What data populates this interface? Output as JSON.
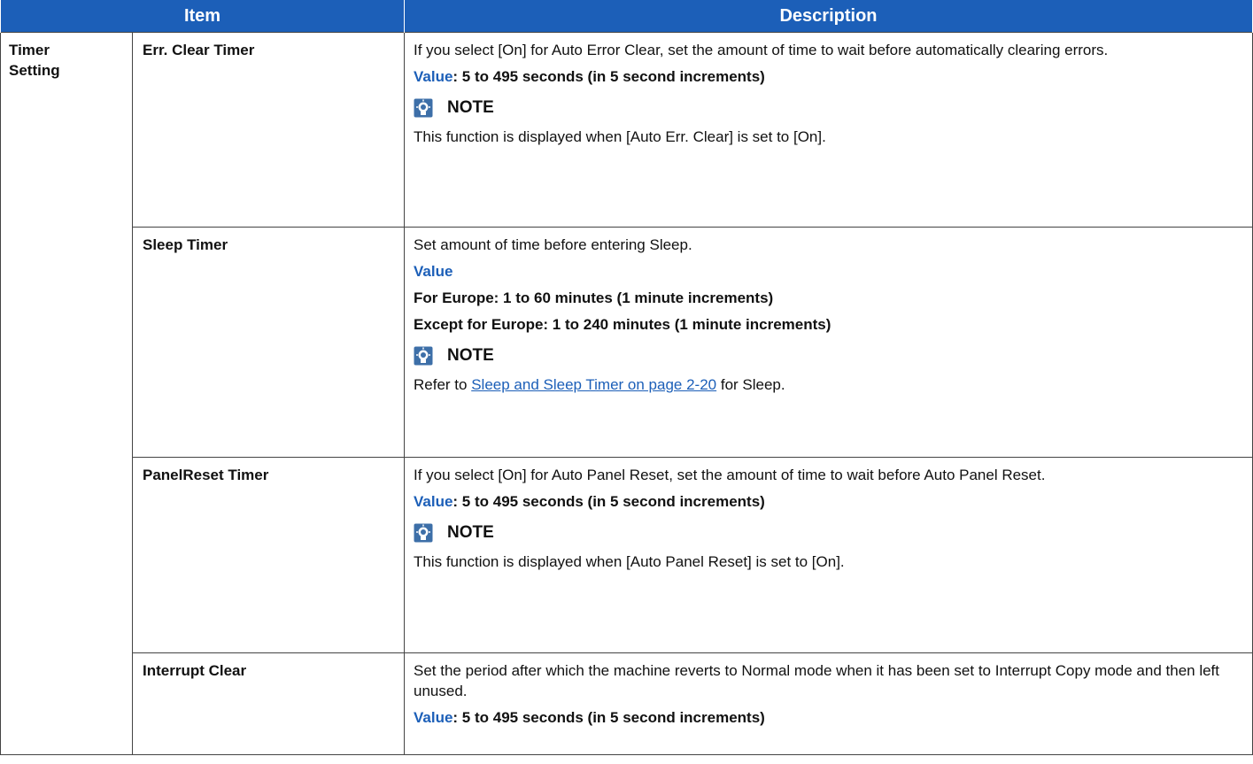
{
  "header": {
    "item": "Item",
    "description": "Description"
  },
  "group": {
    "line1": "Timer",
    "line2": "Setting"
  },
  "colors": {
    "header_bg": "#1c5fb8",
    "accent": "#1c5fb8",
    "border": "#444444"
  },
  "rows": [
    {
      "item": "Err. Clear Timer",
      "text": "If you select [On] for Auto Error Clear, set the amount of time to wait before automatically clearing errors.",
      "value_label": "Value",
      "value_text": ": 5 to 495 seconds (in 5 second increments)",
      "note_icon": "note-icon",
      "note_label": "NOTE",
      "note_text": "This function is displayed when [Auto Err. Clear] is set to [On]."
    },
    {
      "item": "Sleep Timer",
      "text": "Set amount of time before entering Sleep.",
      "value_label": "Value",
      "value_line1": "For Europe: 1 to 60 minutes (1 minute increments)",
      "value_line2": "Except for Europe: 1 to 240 minutes (1 minute increments)",
      "note_icon": "note-icon",
      "note_label": "NOTE",
      "note_prefix": "Refer to ",
      "note_link": "Sleep and Sleep Timer on page 2-20",
      "note_suffix": " for Sleep."
    },
    {
      "item": "PanelReset Timer",
      "text": "If you select [On] for Auto Panel Reset, set the amount of time to wait before Auto Panel Reset.",
      "value_label": "Value",
      "value_text": ": 5 to 495 seconds (in 5 second increments)",
      "note_icon": "note-icon",
      "note_label": "NOTE",
      "note_text": "This function is displayed when [Auto Panel Reset] is set to [On]."
    },
    {
      "item": "Interrupt Clear",
      "text": "Set the period after which the machine reverts to Normal mode when it has been set to Interrupt Copy mode and then left unused.",
      "value_label": "Value",
      "value_text": ": 5 to 495 seconds (in 5 second increments)"
    }
  ]
}
